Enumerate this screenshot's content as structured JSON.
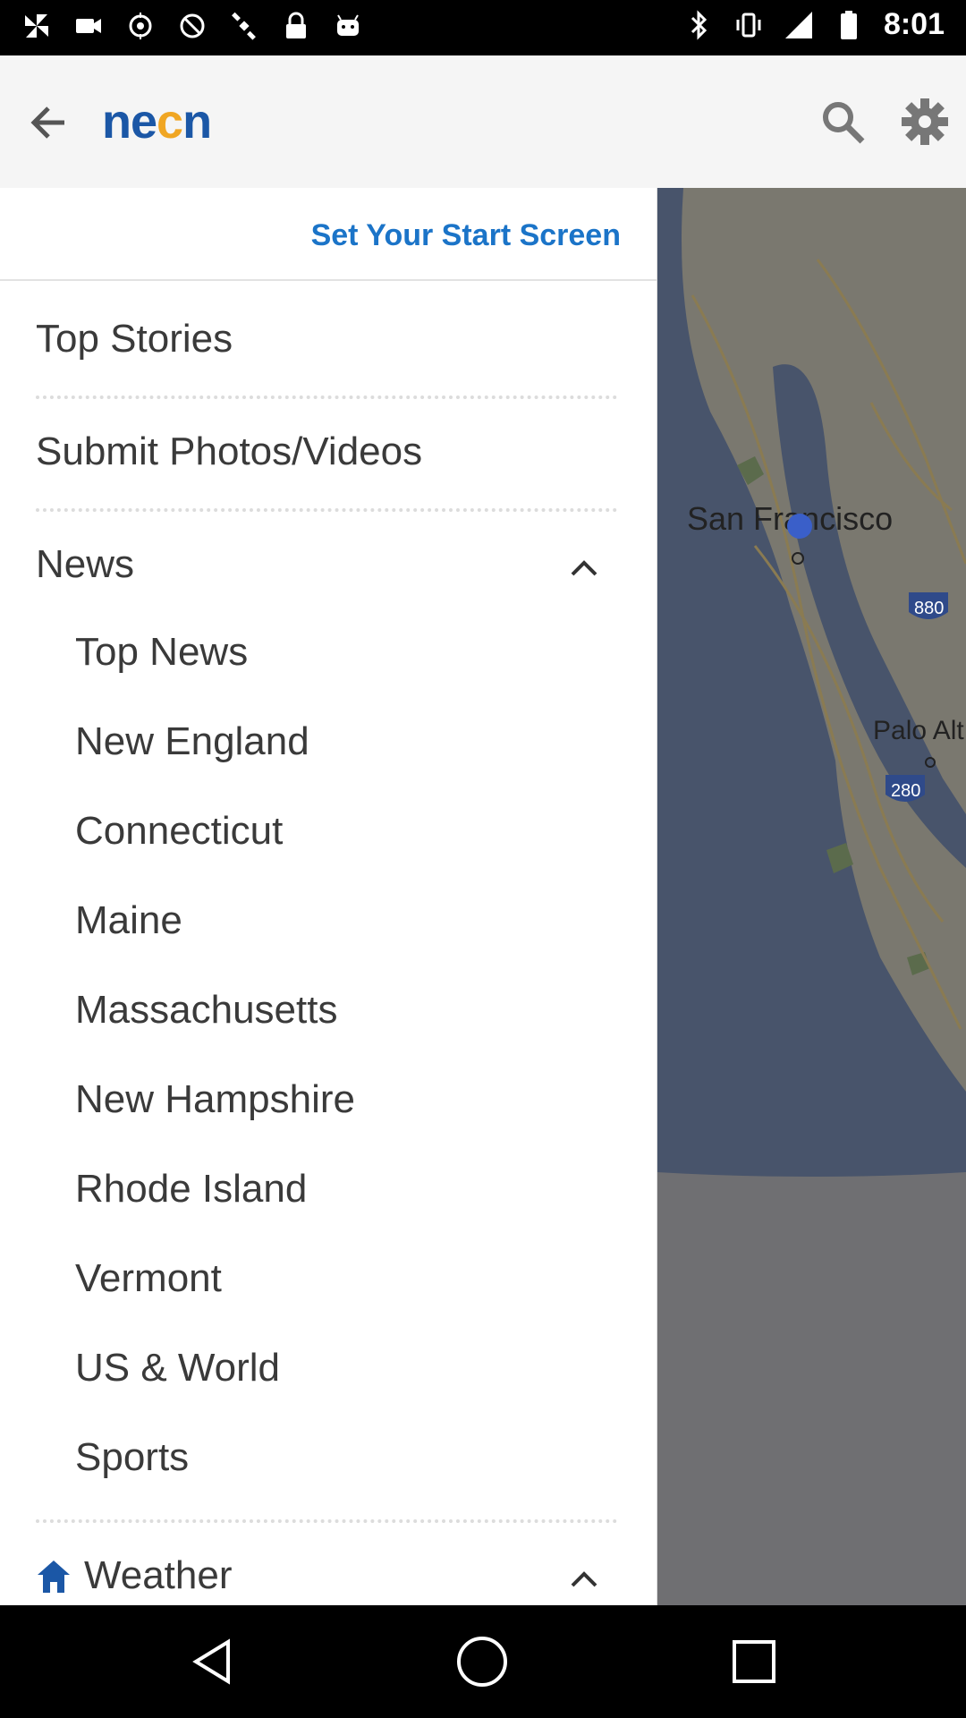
{
  "status_bar": {
    "time": "8:01"
  },
  "app_bar": {
    "logo_pre": "ne",
    "logo_dot": "c",
    "logo_post": "n"
  },
  "drawer": {
    "start_screen_label": "Set Your Start Screen",
    "items": {
      "top_stories": "Top Stories",
      "submit_media": "Submit Photos/Videos",
      "news": "News",
      "weather": "Weather"
    },
    "news_subitems": [
      "Top News",
      "New England",
      "Connecticut",
      "Maine",
      "Massachusetts",
      "New Hampshire",
      "Rhode Island",
      "Vermont",
      "US & World",
      "Sports"
    ]
  },
  "map": {
    "labels": {
      "city_1": "San Francisco",
      "city_2": "Palo Alt",
      "highway_1": "880",
      "highway_2": "280"
    }
  },
  "colors": {
    "brand_blue": "#1b57a6",
    "accent_orange": "#f0a623",
    "link_blue": "#1b74c8"
  }
}
